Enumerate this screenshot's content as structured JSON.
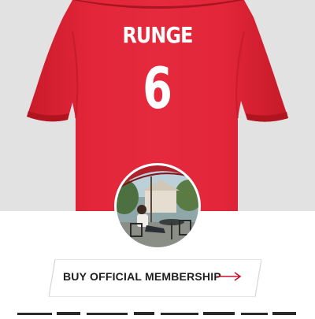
{
  "jersey": {
    "name": "RUNGE",
    "number": "6",
    "color": "#e0232f"
  },
  "cta": {
    "label": "BUY OFFICIAL MEMBERSHIP",
    "accent": "#c8102e"
  },
  "icons": [
    "arrow-right-icon"
  ]
}
